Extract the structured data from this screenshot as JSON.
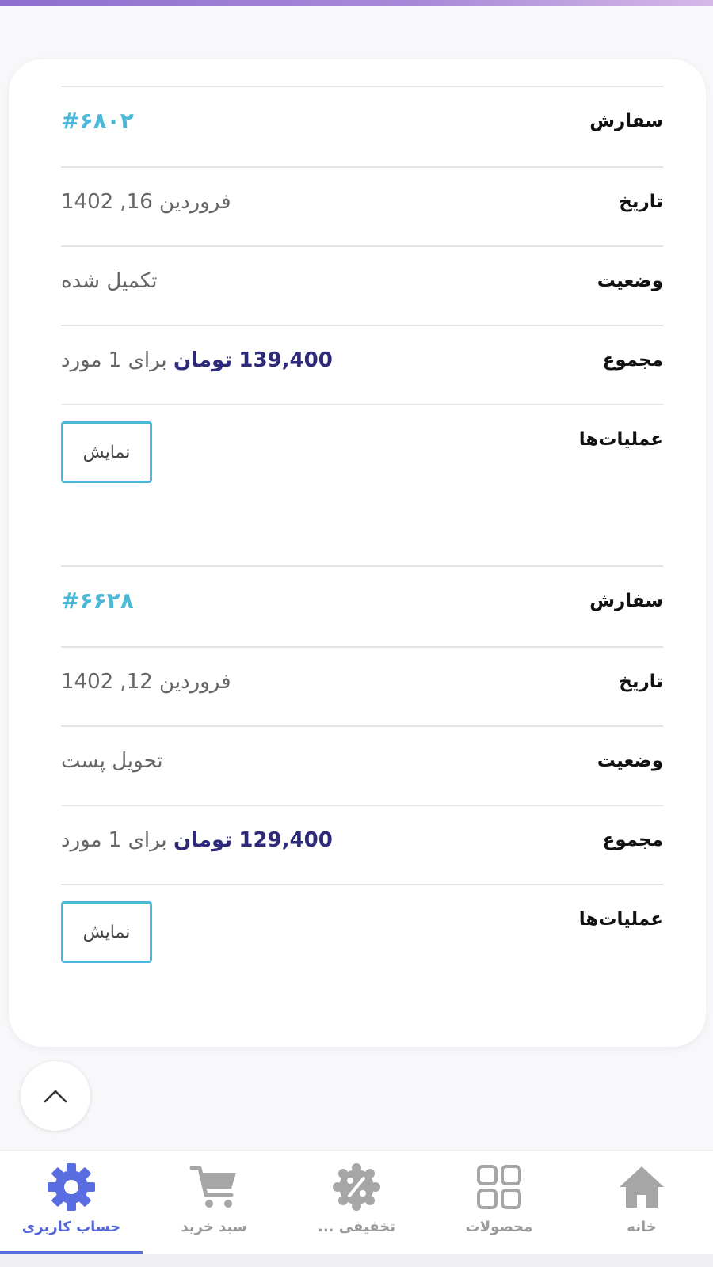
{
  "orders": [
    {
      "order_label": "سفارش",
      "order_id": "#۶۸۰۲",
      "date_label": "تاریخ",
      "date": "فروردین 16, 1402",
      "status_label": "وضعیت",
      "status": "تکمیل شده",
      "total_label": "مجموع",
      "total_amount": "139,400",
      "currency": "تومان",
      "items_text": "برای 1 مورد",
      "actions_label": "عملیات‌ها",
      "view_label": "نمایش"
    },
    {
      "order_label": "سفارش",
      "order_id": "#۶۶۲۸",
      "date_label": "تاریخ",
      "date": "فروردین 12, 1402",
      "status_label": "وضعیت",
      "status": "تحویل پست",
      "total_label": "مجموع",
      "total_amount": "129,400",
      "currency": "تومان",
      "items_text": "برای 1 مورد",
      "actions_label": "عملیات‌ها",
      "view_label": "نمایش"
    }
  ],
  "nav": {
    "home": "خانه",
    "products": "محصولات",
    "discounts": "تخفیفی ...",
    "cart": "سبد خرید",
    "account": "حساب کاربری",
    "active": "account"
  },
  "icons": {
    "scroll_top": "chevron-up-icon",
    "home": "home-icon",
    "products": "grid-icon",
    "discounts": "discount-badge-icon",
    "cart": "cart-icon",
    "account": "gear-icon"
  },
  "colors": {
    "accent": "#4ab8d6",
    "price": "#2e2a7a",
    "nav_active": "#5566d9",
    "nav_inactive": "#9b9b9b"
  }
}
